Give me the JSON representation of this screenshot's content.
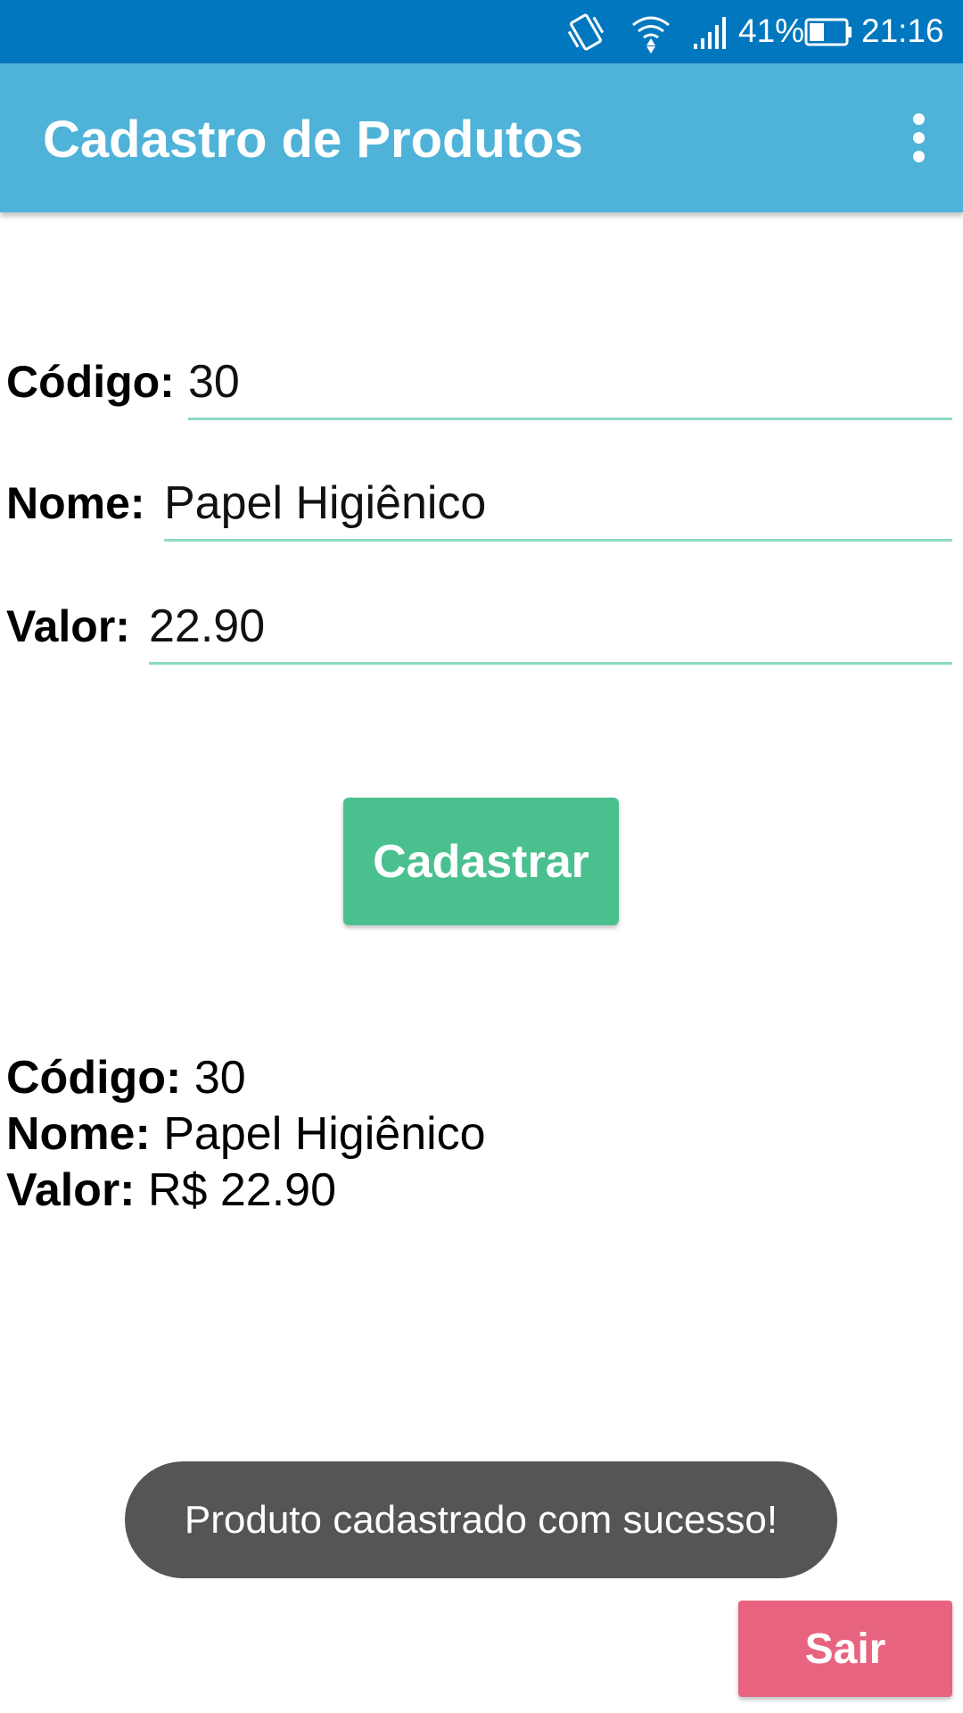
{
  "status_bar": {
    "battery_percent": "41%",
    "time": "21:16",
    "icons": [
      "vibrate-icon",
      "wifi-icon",
      "signal-icon",
      "battery-icon"
    ]
  },
  "app_bar": {
    "title": "Cadastro de Produtos",
    "menu_icon": "overflow-menu-icon"
  },
  "form": {
    "code_label": "Código:",
    "code_value": "30",
    "name_label": "Nome:",
    "name_value": "Papel Higiênico",
    "value_label": "Valor:",
    "value_value": "22.90"
  },
  "register_button": "Cadastrar",
  "result": {
    "code_label": "Código:",
    "code_value": "30",
    "name_label": "Nome:",
    "name_value": "Papel Higiênico",
    "value_label": "Valor:",
    "value_value": "R$ 22.90"
  },
  "toast": "Produto cadastrado com sucesso!",
  "exit_button": "Sair",
  "colors": {
    "status_bar": "#0077bf",
    "app_bar": "#4fb2d8",
    "register_button": "#4bc08f",
    "exit_button": "#e8637f",
    "input_underline": "#8dd9c6",
    "toast_bg": "#555555"
  }
}
